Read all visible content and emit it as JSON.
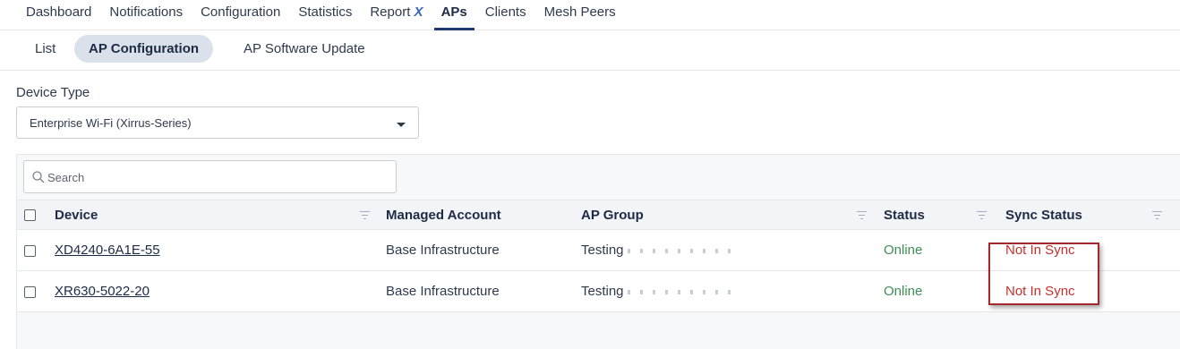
{
  "top_nav": {
    "items": [
      {
        "label": "Dashboard"
      },
      {
        "label": "Notifications"
      },
      {
        "label": "Configuration"
      },
      {
        "label": "Statistics"
      },
      {
        "label": "Report",
        "suffix": "X"
      },
      {
        "label": "APs"
      },
      {
        "label": "Clients"
      },
      {
        "label": "Mesh Peers"
      }
    ],
    "active": "APs"
  },
  "sub_nav": {
    "items": [
      {
        "label": "List"
      },
      {
        "label": "AP Configuration"
      },
      {
        "label": "AP Software Update"
      }
    ],
    "active": "AP Configuration"
  },
  "device_type": {
    "label": "Device Type",
    "selected": "Enterprise Wi-Fi (Xirrus-Series)"
  },
  "search": {
    "placeholder": "Search"
  },
  "table": {
    "columns": [
      "Device",
      "Managed Account",
      "AP Group",
      "Status",
      "Sync Status"
    ],
    "rows": [
      {
        "device": "XD4240-6A1E-55",
        "account": "Base Infrastructure",
        "group": "Testing",
        "status": "Online",
        "sync": "Not In Sync"
      },
      {
        "device": "XR630-5022-20",
        "account": "Base Infrastructure",
        "group": "Testing",
        "status": "Online",
        "sync": "Not In Sync"
      }
    ]
  },
  "colors": {
    "online": "#3f8e55",
    "not_in_sync": "#c4302b",
    "highlight_box": "#a3282c",
    "active_tab_underline": "#1f3a6e"
  }
}
